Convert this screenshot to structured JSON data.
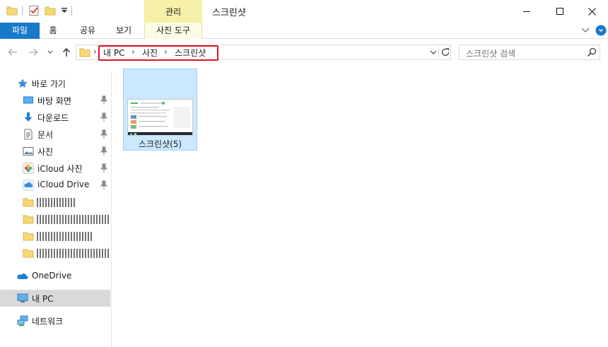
{
  "window": {
    "title": "스크린샷",
    "context_tab_header": "관리",
    "controls": {
      "minimize": "minimize",
      "maximize": "maximize",
      "close": "close"
    }
  },
  "ribbon": {
    "tabs": [
      {
        "label": "파일"
      },
      {
        "label": "홈"
      },
      {
        "label": "공유"
      },
      {
        "label": "보기"
      },
      {
        "label": "사진 도구"
      }
    ]
  },
  "address": {
    "crumbs": [
      "내 PC",
      "사진",
      "스크린샷"
    ],
    "separator": "›"
  },
  "search": {
    "placeholder": "스크린샷 검색"
  },
  "sidebar": {
    "quick_access": "바로 가기",
    "pinned": [
      {
        "label": "바탕 화면",
        "icon": "desktop-icon"
      },
      {
        "label": "다운로드",
        "icon": "download-arrow-icon"
      },
      {
        "label": "문서",
        "icon": "document-icon"
      },
      {
        "label": "사진",
        "icon": "pictures-icon"
      },
      {
        "label": "iCloud 사진",
        "icon": "icloud-photos-icon"
      },
      {
        "label": "iCloud Drive",
        "icon": "icloud-drive-icon"
      }
    ],
    "onedrive": "OneDrive",
    "this_pc": "내 PC",
    "network": "네트워크"
  },
  "files": [
    {
      "name": "스크린샷(5)",
      "selected": true
    }
  ],
  "colors": {
    "accent": "#1979ca",
    "context_tab": "#f6f0a8",
    "selection": "#cce8ff",
    "highlight_box": "#e0141d"
  }
}
